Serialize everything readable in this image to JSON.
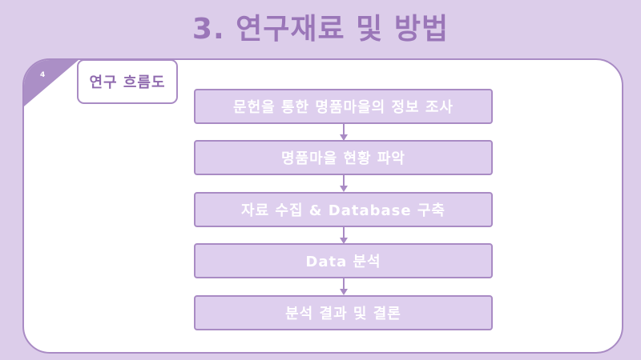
{
  "slide": {
    "title": "3. 연구재료 및 방법",
    "page_number": "4",
    "section_label": "연구 흐름도"
  },
  "flow": {
    "steps": [
      {
        "label": "문헌을 통한 명품마을의 정보 조사"
      },
      {
        "label": "명품마을 현황 파악"
      },
      {
        "label": "자료 수집 & Database 구축"
      },
      {
        "label": "Data 분석"
      },
      {
        "label": "분석 결과 및 결론"
      }
    ]
  },
  "colors": {
    "background": "#dccdea",
    "panel": "#ffffff",
    "accent": "#a98bc4",
    "title": "#9a76b8",
    "step_fill": "#decfee",
    "step_text": "#ffffff",
    "arrow": "#a98bc4"
  }
}
